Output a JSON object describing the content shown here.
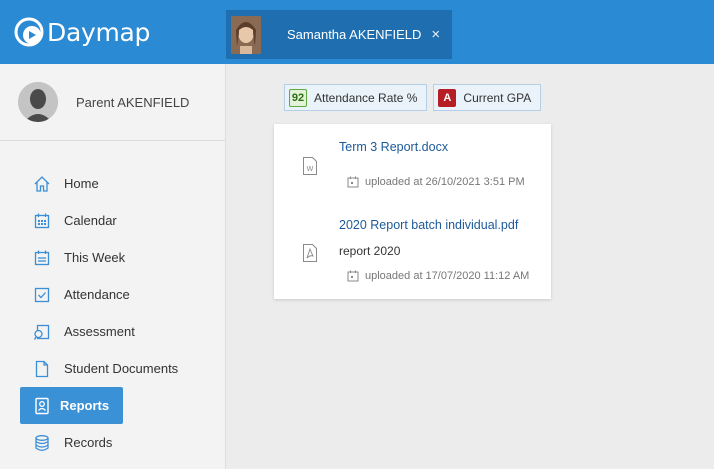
{
  "header": {
    "brand": "Daymap",
    "student_tab": {
      "name": "Samantha AKENFIELD",
      "close": "×"
    }
  },
  "sidebar": {
    "parent_name": "Parent AKENFIELD",
    "items": [
      {
        "label": "Home",
        "icon": "home-icon"
      },
      {
        "label": "Calendar",
        "icon": "calendar-icon"
      },
      {
        "label": "This Week",
        "icon": "this-week-icon"
      },
      {
        "label": "Attendance",
        "icon": "checkbox-icon"
      },
      {
        "label": "Assessment",
        "icon": "assessment-icon"
      },
      {
        "label": "Student Documents",
        "icon": "document-icon"
      },
      {
        "label": "Reports",
        "icon": "report-icon",
        "active": true
      },
      {
        "label": "Records",
        "icon": "database-icon"
      }
    ]
  },
  "filters": {
    "attendance": {
      "badge": "92",
      "label": "Attendance Rate %"
    },
    "gpa": {
      "badge": "A",
      "label": "Current GPA"
    }
  },
  "documents": [
    {
      "title": "Term 3 Report.docx",
      "description": "",
      "uploaded": "uploaded at 26/10/2021 3:51 PM",
      "icon": "word-file-icon"
    },
    {
      "title": "2020 Report batch individual.pdf",
      "description": "report 2020",
      "uploaded": "uploaded at 17/07/2020 11:12 AM",
      "icon": "pdf-file-icon"
    }
  ],
  "colors": {
    "topbar": "#2a8ad3",
    "tab": "#1f6fb0",
    "active_nav": "#3b91d6",
    "link": "#1d5a9a",
    "gpa_badge": "#b51f24",
    "attendance_badge": "#5fa83b"
  }
}
